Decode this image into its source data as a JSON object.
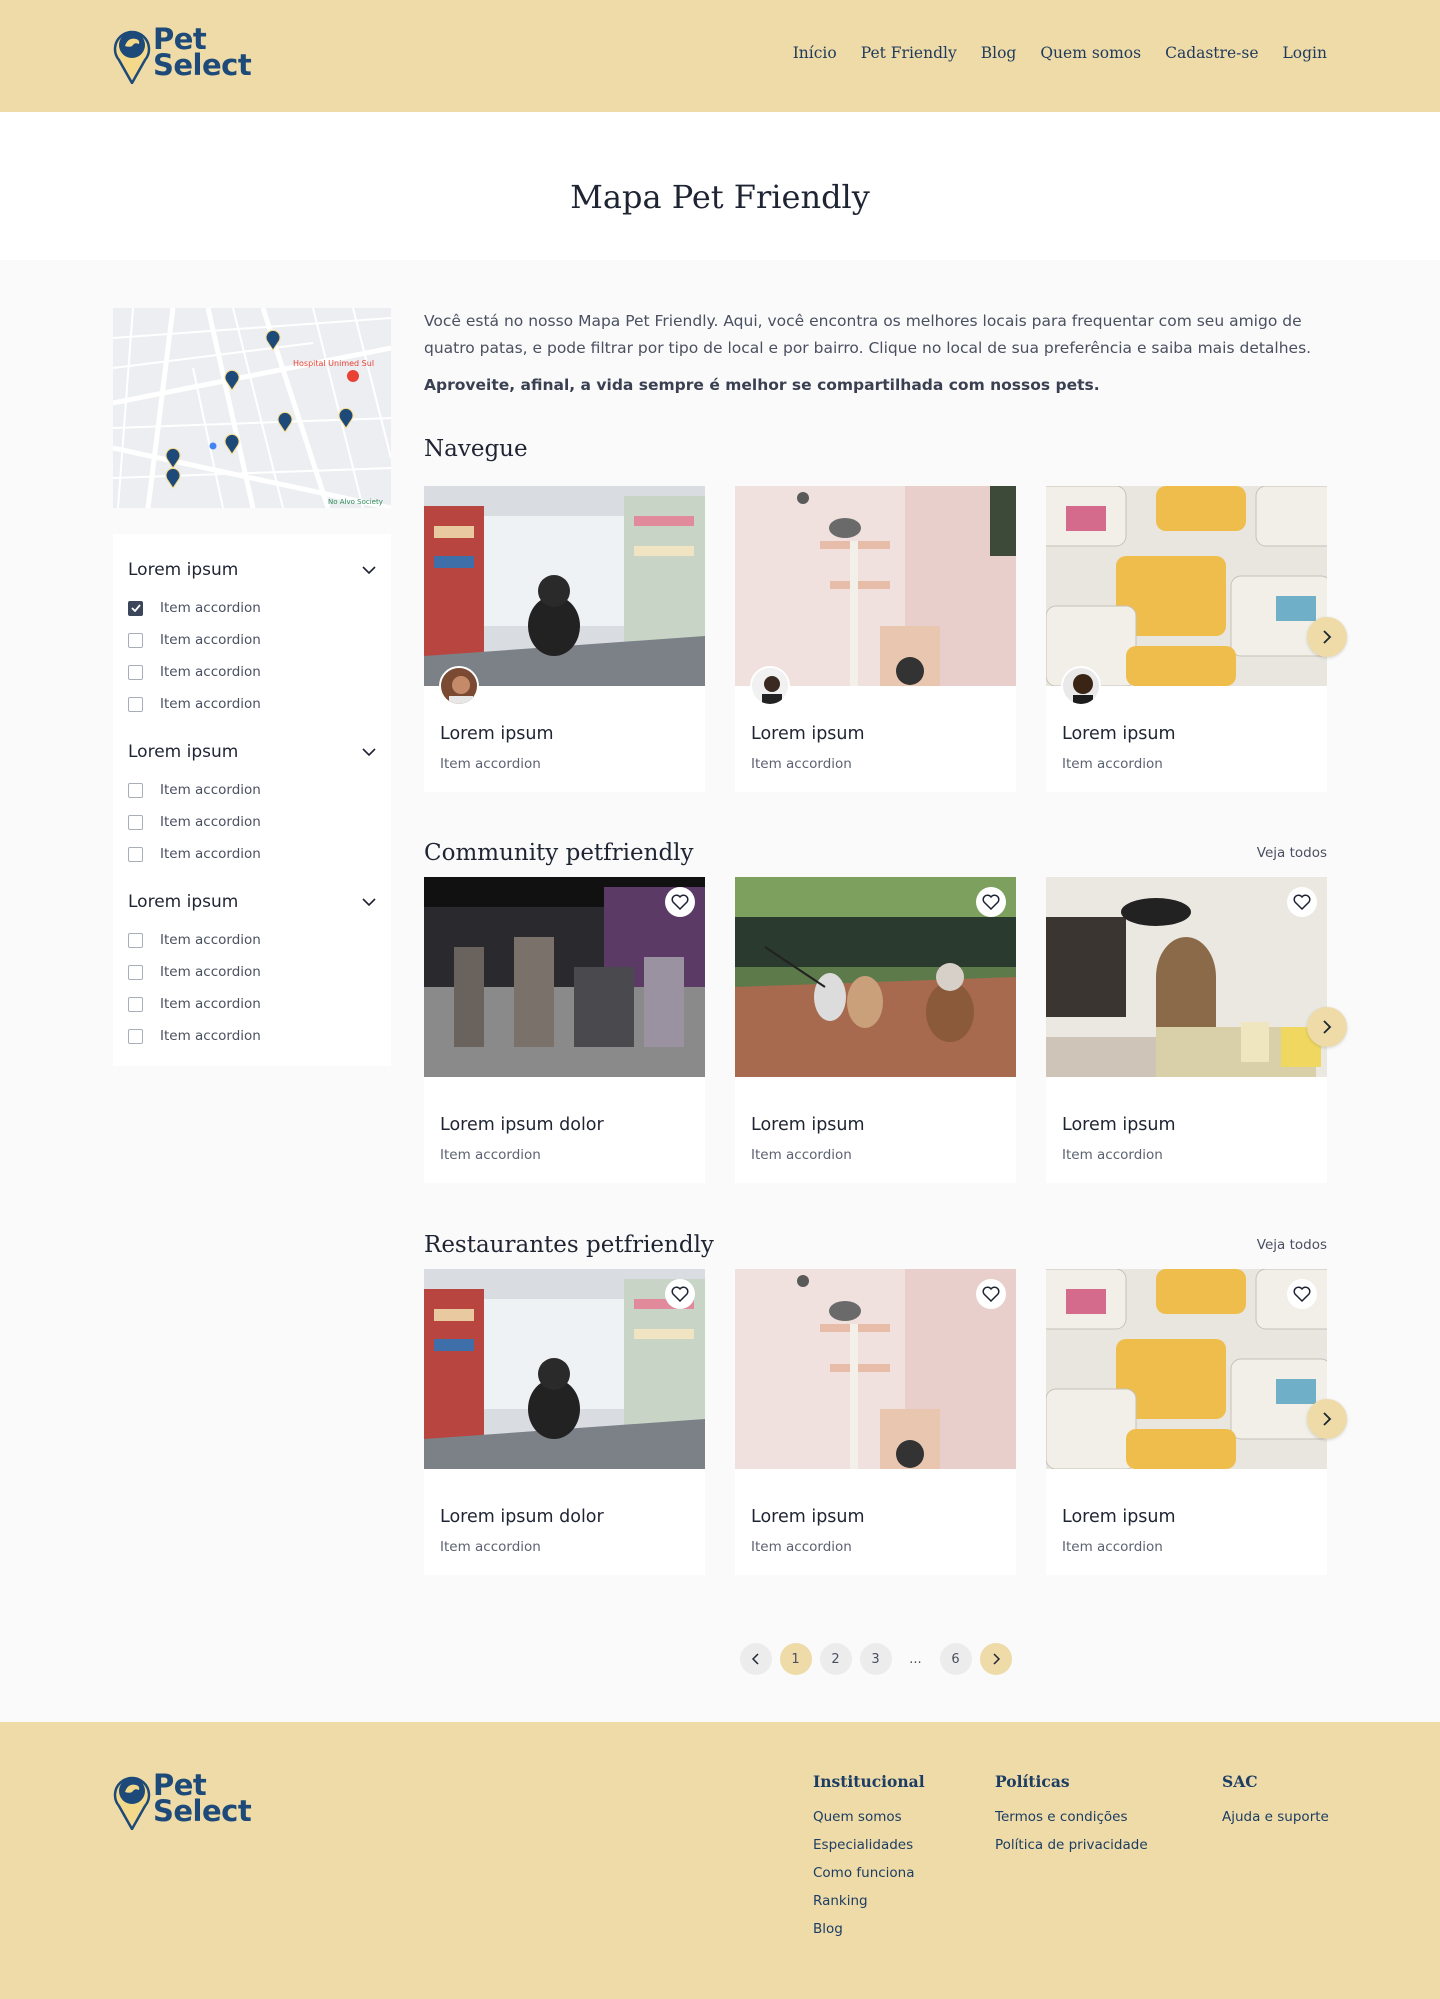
{
  "brand": {
    "line1": "Pet",
    "line2": "Select",
    "color": "#1d4a78",
    "accent": "#eedba8"
  },
  "nav": [
    "Início",
    "Pet Friendly",
    "Blog",
    "Quem somos",
    "Cadastre-se",
    "Login"
  ],
  "page_title": "Mapa Pet Friendly",
  "map": {
    "labels": [
      "Hospital Unimed Sul",
      "No Alvo Society"
    ],
    "pin_count": 7
  },
  "filters": [
    {
      "title": "Lorem ipsum",
      "items": [
        {
          "label": "Item accordion",
          "checked": true
        },
        {
          "label": "Item accordion",
          "checked": false
        },
        {
          "label": "Item accordion",
          "checked": false
        },
        {
          "label": "Item accordion",
          "checked": false
        }
      ]
    },
    {
      "title": "Lorem ipsum",
      "items": [
        {
          "label": "Item accordion",
          "checked": false
        },
        {
          "label": "Item accordion",
          "checked": false
        },
        {
          "label": "Item accordion",
          "checked": false
        }
      ]
    },
    {
      "title": "Lorem ipsum",
      "items": [
        {
          "label": "Item accordion",
          "checked": false
        },
        {
          "label": "Item accordion",
          "checked": false
        },
        {
          "label": "Item accordion",
          "checked": false
        },
        {
          "label": "Item accordion",
          "checked": false
        }
      ]
    }
  ],
  "intro": {
    "text": "Você está no nosso Mapa Pet Friendly. Aqui, você encontra os melhores locais para frequentar com seu amigo de quatro patas, e pode filtrar por tipo de local e por bairro. Clique no local de sua preferência e saiba mais detalhes.",
    "bold": "Aproveite, afinal, a vida sempre é melhor se compartilhada com nossos pets."
  },
  "sections": [
    {
      "title": "Navegue",
      "see_all": "",
      "cards": [
        {
          "title": "Lorem ipsum",
          "sub": "Item accordion",
          "image": "dog-in-pet-store",
          "avatar": true,
          "favorite": false
        },
        {
          "title": "Lorem ipsum",
          "sub": "Item accordion",
          "image": "cat-on-cat-tree",
          "avatar": true,
          "favorite": false
        },
        {
          "title": "Lorem ipsum",
          "sub": "Item accordion",
          "image": "pet-food-trays",
          "avatar": true,
          "favorite": false
        }
      ]
    },
    {
      "title": "Community petfriendly",
      "see_all": "Veja todos",
      "cards": [
        {
          "title": "Lorem ipsum dolor",
          "sub": "Item accordion",
          "image": "pet-shop-interior",
          "avatar": false,
          "favorite": true
        },
        {
          "title": "Lorem ipsum",
          "sub": "Item accordion",
          "image": "dogs-on-leash-street",
          "avatar": false,
          "favorite": true
        },
        {
          "title": "Lorem ipsum",
          "sub": "Item accordion",
          "image": "bookstore-with-dog",
          "avatar": false,
          "favorite": true
        }
      ]
    },
    {
      "title": "Restaurantes petfriendly",
      "see_all": "Veja todos",
      "cards": [
        {
          "title": "Lorem ipsum dolor",
          "sub": "Item accordion",
          "image": "dog-in-pet-store",
          "avatar": false,
          "favorite": true
        },
        {
          "title": "Lorem ipsum",
          "sub": "Item accordion",
          "image": "cat-on-cat-tree",
          "avatar": false,
          "favorite": true
        },
        {
          "title": "Lorem ipsum",
          "sub": "Item accordion",
          "image": "pet-food-trays",
          "avatar": false,
          "favorite": true
        }
      ]
    }
  ],
  "pagination": {
    "pages": [
      "1",
      "2",
      "3",
      "...",
      "6"
    ],
    "current": "1"
  },
  "footer": {
    "columns": [
      {
        "title": "Institucional",
        "links": [
          "Quem somos",
          "Especialidades",
          "Como funciona",
          "Ranking",
          "Blog"
        ]
      },
      {
        "title": "Políticas",
        "links": [
          "Termos e condições",
          "Política de privacidade"
        ]
      },
      {
        "title": "SAC",
        "links": [
          "Ajuda e suporte"
        ]
      }
    ]
  }
}
